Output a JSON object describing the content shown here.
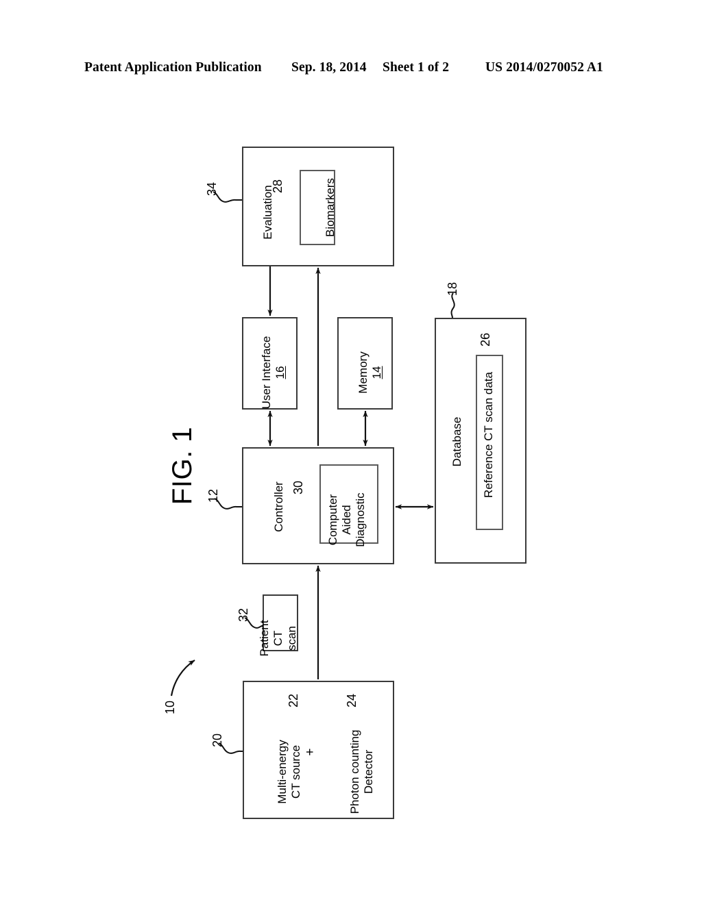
{
  "header": {
    "publication": "Patent Application Publication",
    "date": "Sep. 18, 2014",
    "sheet": "Sheet 1 of 2",
    "number": "US 2014/0270052 A1"
  },
  "figure": {
    "caption": "FIG. 1",
    "system_numeral": "10"
  },
  "blocks": {
    "evaluation": {
      "label": "Evaluation",
      "numeral": "34"
    },
    "biomarkers": {
      "label": "Biomarkers",
      "numeral": "28"
    },
    "user_interface": {
      "label": "User Interface",
      "numeral": "16"
    },
    "memory": {
      "label": "Memory",
      "numeral": "14"
    },
    "controller": {
      "label": "Controller",
      "numeral": "12"
    },
    "cad": {
      "line1": "Computer",
      "line2": "Aided",
      "line3": "Diagnostic",
      "numeral": "30"
    },
    "database": {
      "label": "Database",
      "numeral": "18"
    },
    "reference_scan": {
      "label": "Reference CT scan data",
      "numeral": "26"
    },
    "patient_scan": {
      "line1": "Patient",
      "line2": "CT",
      "line3": "scan",
      "numeral": "32"
    },
    "ct_system": {
      "numeral": "20"
    },
    "ct_source": {
      "line1": "Multi-energy",
      "line2": "CT source",
      "numeral": "22"
    },
    "detector": {
      "line1": "Photon counting",
      "line2": "Detector",
      "numeral": "24"
    },
    "plus_operator": {
      "label": "+"
    }
  },
  "colors": {
    "ink": "#000000",
    "box_stroke": "#3a3a3a",
    "page_background": "#ffffff"
  }
}
